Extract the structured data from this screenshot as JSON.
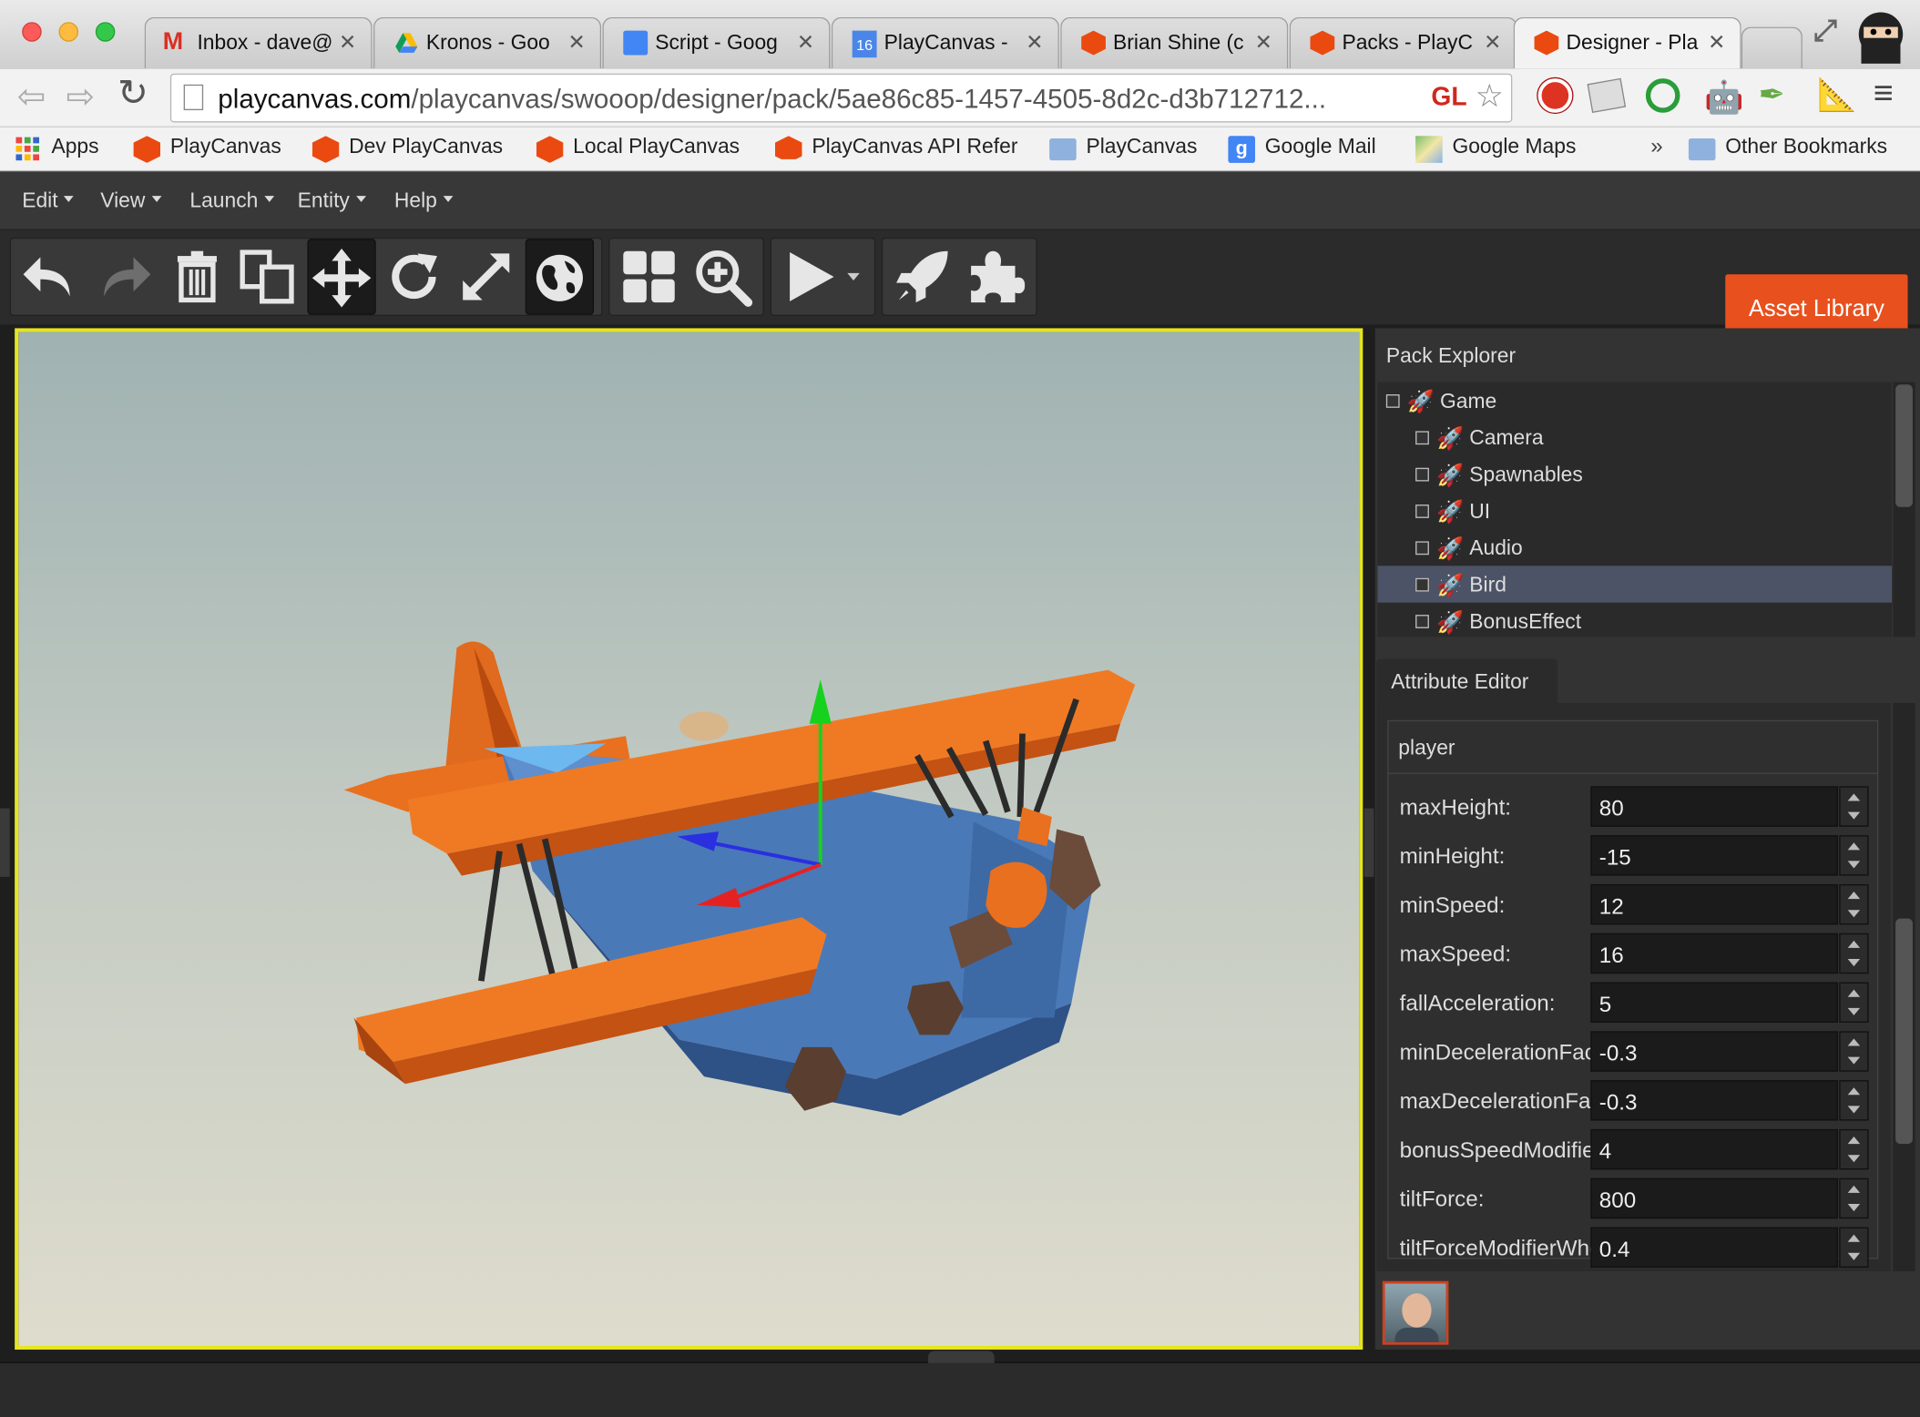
{
  "browser": {
    "tabs": [
      {
        "title": "Inbox - dave@",
        "icon": "gmail-icon"
      },
      {
        "title": "Kronos - Goo",
        "icon": "google-drive-icon"
      },
      {
        "title": "Script - Goog",
        "icon": "google-docs-icon"
      },
      {
        "title": "PlayCanvas -",
        "icon": "calendar-icon",
        "badge": "16"
      },
      {
        "title": "Brian Shine (c",
        "icon": "playcanvas-icon"
      },
      {
        "title": "Packs - PlayC",
        "icon": "playcanvas-icon"
      },
      {
        "title": "Designer - Pla",
        "icon": "playcanvas-icon"
      }
    ],
    "url_host": "playcanvas.com",
    "url_path": "/playcanvas/swooop/designer/pack/5ae86c85-1457-4505-8d2c-d3b712712...",
    "url_badge": "GL",
    "bookmarks": [
      {
        "label": "Apps",
        "icon": "apps-grid-icon"
      },
      {
        "label": "PlayCanvas",
        "icon": "playcanvas-icon"
      },
      {
        "label": "Dev PlayCanvas",
        "icon": "playcanvas-icon"
      },
      {
        "label": "Local PlayCanvas",
        "icon": "playcanvas-icon"
      },
      {
        "label": "PlayCanvas API Refer",
        "icon": "playcanvas-icon"
      },
      {
        "label": "PlayCanvas",
        "icon": "folder-icon"
      },
      {
        "label": "Google Mail",
        "icon": "google-icon"
      },
      {
        "label": "Google Maps",
        "icon": "maps-icon"
      }
    ],
    "overflow": "»",
    "other_bookmarks": "Other Bookmarks"
  },
  "menu": [
    "Edit",
    "View",
    "Launch",
    "Entity",
    "Help"
  ],
  "toolbar": {
    "asset_library": "Asset Library",
    "colors": {
      "accent": "#e8501e",
      "viewport_border": "#e6e51e",
      "selection": "#4d5366"
    }
  },
  "pack_explorer": {
    "title": "Pack Explorer",
    "root": "Game",
    "items": [
      "Camera",
      "Spawnables",
      "UI",
      "Audio",
      "Bird",
      "BonusEffect"
    ],
    "selected": "Bird"
  },
  "attribute_editor": {
    "title": "Attribute Editor",
    "group": "player",
    "rows": [
      {
        "label": "maxHeight:",
        "value": "80"
      },
      {
        "label": "minHeight:",
        "value": "-15"
      },
      {
        "label": "minSpeed:",
        "value": "12"
      },
      {
        "label": "maxSpeed:",
        "value": "16"
      },
      {
        "label": "fallAcceleration:",
        "value": "5"
      },
      {
        "label": "minDecelerationFactor",
        "value": "-0.3"
      },
      {
        "label": "maxDecelerationFactor",
        "value": "-0.3"
      },
      {
        "label": "bonusSpeedModifier",
        "value": "4"
      },
      {
        "label": "tiltForce:",
        "value": "800"
      },
      {
        "label": "tiltForceModifierWhen",
        "value": "0.4"
      }
    ]
  }
}
